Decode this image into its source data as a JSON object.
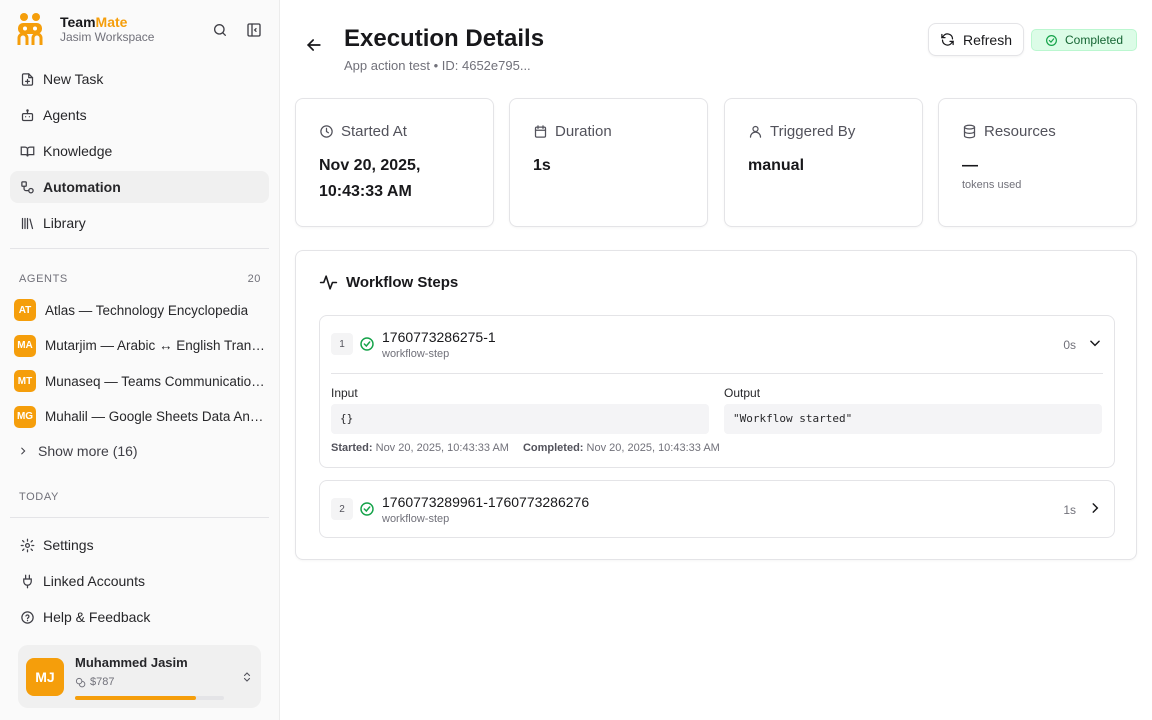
{
  "brand": {
    "name_part1": "Team",
    "name_part2": "Mate",
    "workspace": "Jasim Workspace"
  },
  "nav": {
    "items": [
      {
        "label": "New Task",
        "icon": "file-plus-icon"
      },
      {
        "label": "Agents",
        "icon": "bot-icon"
      },
      {
        "label": "Knowledge",
        "icon": "book-icon"
      },
      {
        "label": "Automation",
        "icon": "workflow-icon",
        "active": true
      },
      {
        "label": "Library",
        "icon": "library-icon"
      }
    ]
  },
  "agents": {
    "heading": "AGENTS",
    "count": "20",
    "items": [
      {
        "initials": "AT",
        "name": "Atlas — Technology Encyclopedia"
      },
      {
        "initials": "MA",
        "name": "Mutarjim — Arabic ↔ English Translator"
      },
      {
        "initials": "MT",
        "name": "Munaseq — Teams Communication Assistant"
      },
      {
        "initials": "MG",
        "name": "Muhalil — Google Sheets Data Analyst"
      }
    ],
    "show_more": "Show more (16)"
  },
  "today": {
    "heading": "TODAY"
  },
  "bottom_nav": {
    "items": [
      {
        "label": "Settings",
        "icon": "gear-icon"
      },
      {
        "label": "Linked Accounts",
        "icon": "plug-icon"
      },
      {
        "label": "Help & Feedback",
        "icon": "help-icon"
      }
    ]
  },
  "user": {
    "initials": "MJ",
    "name": "Muhammed Jasim",
    "balance": "$787",
    "usage_fraction": 0.81
  },
  "header": {
    "title": "Execution Details",
    "subtitle": "App action test • ID: 4652e795...",
    "refresh_label": "Refresh",
    "status": "Completed"
  },
  "stats": [
    {
      "label": "Started At",
      "value": "Nov 20, 2025, 10:43:33 AM",
      "icon": "clock-icon"
    },
    {
      "label": "Duration",
      "value": "1s",
      "icon": "calendar-icon"
    },
    {
      "label": "Triggered By",
      "value": "manual",
      "icon": "user-icon"
    },
    {
      "label": "Resources",
      "value": "—",
      "sub": "tokens used",
      "icon": "database-icon"
    }
  ],
  "workflow": {
    "title": "Workflow Steps",
    "steps": [
      {
        "num": "1",
        "name": "1760773286275-1",
        "type": "workflow-step",
        "duration": "0s",
        "input_label": "Input",
        "input_value": "{}",
        "output_label": "Output",
        "output_value": "\"Workflow started\"",
        "started_label": "Started:",
        "started_value": "Nov 20, 2025, 10:43:33 AM",
        "completed_label": "Completed:",
        "completed_value": "Nov 20, 2025, 10:43:33 AM"
      },
      {
        "num": "2",
        "name": "1760773289961-1760773286276",
        "type": "workflow-step",
        "duration": "1s"
      }
    ]
  },
  "colors": {
    "accent": "#f59e0b",
    "success": "#16a34a",
    "success_bg": "#dcfce7"
  }
}
